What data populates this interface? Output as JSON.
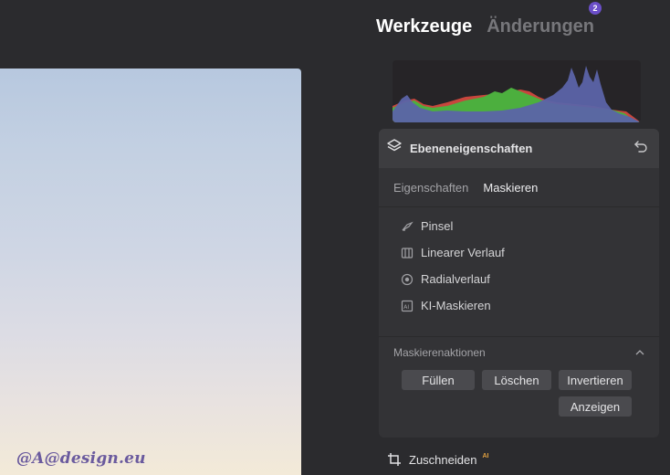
{
  "tabs": {
    "tools_label": "Werkzeuge",
    "changes_label": "Änderungen",
    "changes_badge": "2"
  },
  "layer": {
    "title": "Ebeneneigenschaften",
    "subtabs": [
      "Eigenschaften",
      "Maskieren"
    ],
    "tools": [
      {
        "label": "Pinsel",
        "icon": "brush-icon"
      },
      {
        "label": "Linearer Verlauf",
        "icon": "linear-gradient-icon"
      },
      {
        "label": "Radialverlauf",
        "icon": "radial-gradient-icon"
      },
      {
        "label": "KI-Maskieren",
        "icon": "ai-mask-icon"
      }
    ],
    "actions_label": "Maskierenaktionen",
    "buttons": {
      "fill": "Füllen",
      "delete": "Löschen",
      "invert": "Invertieren",
      "show": "Anzeigen"
    }
  },
  "crop": {
    "label": "Zuschneiden",
    "badge": "AI"
  },
  "watermark": "@A@design.eu"
}
